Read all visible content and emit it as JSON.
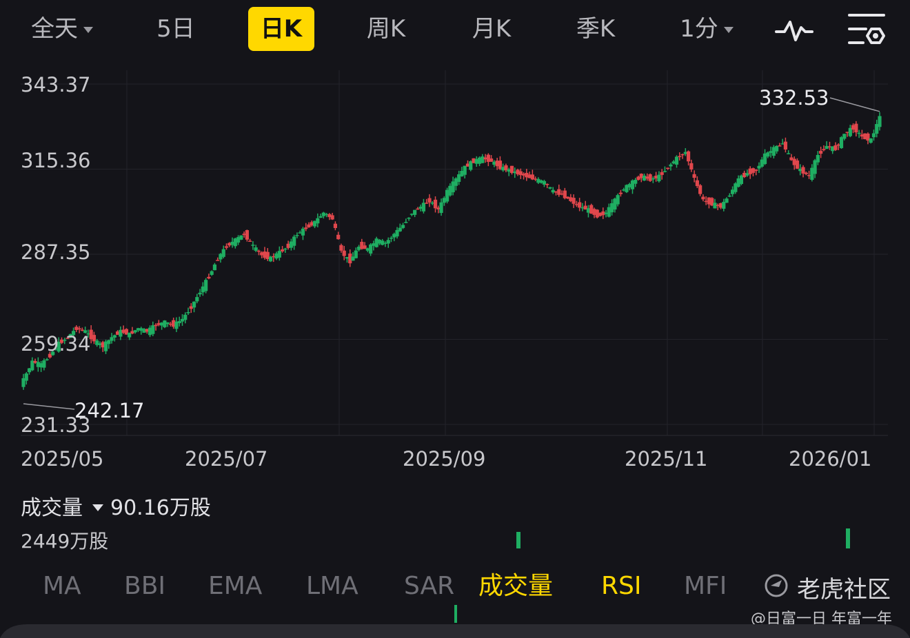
{
  "toolbar": {
    "tabs": [
      {
        "label": "全天",
        "dropdown": true
      },
      {
        "label": "5日"
      },
      {
        "label": "日K",
        "active": true
      },
      {
        "label": "周K"
      },
      {
        "label": "月K"
      },
      {
        "label": "季K"
      },
      {
        "label": "1分",
        "dropdown": true
      }
    ],
    "icons": [
      "line-chart-icon",
      "chart-settings-icon"
    ]
  },
  "chart_data": {
    "type": "candlestick",
    "y_ticks": [
      "343.37",
      "315.36",
      "287.35",
      "259.34",
      "231.33"
    ],
    "y_tick_values": [
      343.37,
      315.36,
      287.35,
      259.34,
      231.33
    ],
    "ylim": [
      231.33,
      343.37
    ],
    "x_ticks": [
      "2025/05",
      "2025/07",
      "2025/09",
      "2025/11",
      "2026/01"
    ],
    "max_label": "332.53",
    "min_label": "242.17",
    "up_color": "#1fae62",
    "down_color": "#e0474c",
    "background": "#141419",
    "grid": true,
    "approx_closes": [
      246,
      252,
      251,
      254,
      258,
      260,
      263,
      262,
      259,
      257,
      260,
      262,
      261,
      263,
      262,
      264,
      265,
      264,
      266,
      270,
      275,
      280,
      286,
      290,
      292,
      294,
      290,
      287,
      286,
      288,
      290,
      294,
      296,
      298,
      301,
      299,
      288,
      285,
      290,
      289,
      292,
      291,
      294,
      297,
      301,
      303,
      305,
      302,
      308,
      312,
      316,
      318,
      319,
      318,
      316,
      315,
      314,
      313,
      312,
      311,
      308,
      307,
      305,
      303,
      302,
      300,
      301,
      305,
      309,
      311,
      313,
      312,
      313,
      316,
      319,
      321,
      312,
      305,
      304,
      303,
      307,
      312,
      314,
      315,
      320,
      322,
      324,
      318,
      315,
      313,
      320,
      323,
      322,
      327,
      329,
      326,
      325,
      332.53
    ]
  },
  "volume": {
    "label": "成交量",
    "value": "90.16万股",
    "max_label": "2449万股",
    "spikes": [
      {
        "at": 0.5,
        "h": 0.7
      },
      {
        "at": 0.88,
        "h": 0.85
      }
    ]
  },
  "indicator_tabs": [
    {
      "label": "MA"
    },
    {
      "label": "BBI"
    },
    {
      "label": "EMA"
    },
    {
      "label": "LMA"
    },
    {
      "label": "SAR"
    },
    {
      "label": "成交量",
      "active": true
    },
    {
      "label": "RSI",
      "active": true
    },
    {
      "label": "MFI"
    }
  ],
  "watermark": "老虎社区",
  "credit": "@日富一日 年富一年"
}
